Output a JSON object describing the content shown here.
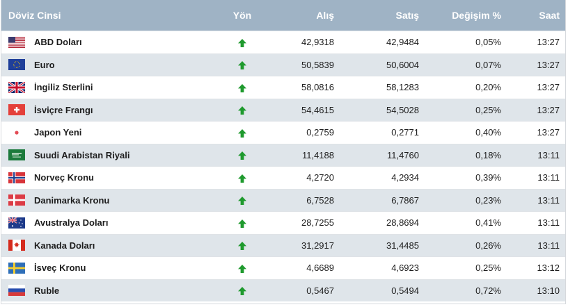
{
  "header": {
    "currency": "Döviz Cinsi",
    "direction": "Yön",
    "buy": "Alış",
    "sell": "Satış",
    "change": "Değişim %",
    "time": "Saat"
  },
  "colors": {
    "header_bg": "#9fb3c5",
    "alt_row_bg": "#dfe5ea",
    "up_arrow": "#1f9a2e"
  },
  "rows": [
    {
      "name": "ABD Doları",
      "flag": "us-flag-icon",
      "direction": "up-arrow-icon",
      "buy": "42,9318",
      "sell": "42,9484",
      "change": "0,05%",
      "time": "13:27"
    },
    {
      "name": "Euro",
      "flag": "eu-flag-icon",
      "direction": "up-arrow-icon",
      "buy": "50,5839",
      "sell": "50,6004",
      "change": "0,07%",
      "time": "13:27"
    },
    {
      "name": "İngiliz Sterlini",
      "flag": "gb-flag-icon",
      "direction": "up-arrow-icon",
      "buy": "58,0816",
      "sell": "58,1283",
      "change": "0,20%",
      "time": "13:27"
    },
    {
      "name": "İsviçre Frangı",
      "flag": "ch-flag-icon",
      "direction": "up-arrow-icon",
      "buy": "54,4615",
      "sell": "54,5028",
      "change": "0,25%",
      "time": "13:27"
    },
    {
      "name": "Japon Yeni",
      "flag": "jp-flag-icon",
      "direction": "up-arrow-icon",
      "buy": "0,2759",
      "sell": "0,2771",
      "change": "0,40%",
      "time": "13:27"
    },
    {
      "name": "Suudi Arabistan Riyali",
      "flag": "sa-flag-icon",
      "direction": "up-arrow-icon",
      "buy": "11,4188",
      "sell": "11,4760",
      "change": "0,18%",
      "time": "13:11"
    },
    {
      "name": "Norveç Kronu",
      "flag": "no-flag-icon",
      "direction": "up-arrow-icon",
      "buy": "4,2720",
      "sell": "4,2934",
      "change": "0,39%",
      "time": "13:11"
    },
    {
      "name": "Danimarka Kronu",
      "flag": "dk-flag-icon",
      "direction": "up-arrow-icon",
      "buy": "6,7528",
      "sell": "6,7867",
      "change": "0,23%",
      "time": "13:11"
    },
    {
      "name": "Avustralya Doları",
      "flag": "au-flag-icon",
      "direction": "up-arrow-icon",
      "buy": "28,7255",
      "sell": "28,8694",
      "change": "0,41%",
      "time": "13:11"
    },
    {
      "name": "Kanada Doları",
      "flag": "ca-flag-icon",
      "direction": "up-arrow-icon",
      "buy": "31,2917",
      "sell": "31,4485",
      "change": "0,26%",
      "time": "13:11"
    },
    {
      "name": "İsveç Kronu",
      "flag": "se-flag-icon",
      "direction": "up-arrow-icon",
      "buy": "4,6689",
      "sell": "4,6923",
      "change": "0,25%",
      "time": "13:12"
    },
    {
      "name": "Ruble",
      "flag": "ru-flag-icon",
      "direction": "up-arrow-icon",
      "buy": "0,5467",
      "sell": "0,5494",
      "change": "0,72%",
      "time": "13:10"
    }
  ]
}
